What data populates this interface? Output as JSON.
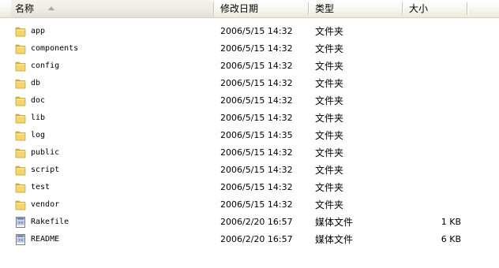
{
  "columns": {
    "name": "名称",
    "modified": "修改日期",
    "type": "类型",
    "size": "大小"
  },
  "files": [
    {
      "name": "app",
      "modified": "2006/5/15 14:32",
      "type": "文件夹",
      "size": "",
      "icon": "folder-icon"
    },
    {
      "name": "components",
      "modified": "2006/5/15 14:32",
      "type": "文件夹",
      "size": "",
      "icon": "folder-icon"
    },
    {
      "name": "config",
      "modified": "2006/5/15 14:32",
      "type": "文件夹",
      "size": "",
      "icon": "folder-icon"
    },
    {
      "name": "db",
      "modified": "2006/5/15 14:32",
      "type": "文件夹",
      "size": "",
      "icon": "folder-icon"
    },
    {
      "name": "doc",
      "modified": "2006/5/15 14:32",
      "type": "文件夹",
      "size": "",
      "icon": "folder-icon"
    },
    {
      "name": "lib",
      "modified": "2006/5/15 14:32",
      "type": "文件夹",
      "size": "",
      "icon": "folder-icon"
    },
    {
      "name": "log",
      "modified": "2006/5/15 14:35",
      "type": "文件夹",
      "size": "",
      "icon": "folder-icon"
    },
    {
      "name": "public",
      "modified": "2006/5/15 14:32",
      "type": "文件夹",
      "size": "",
      "icon": "folder-icon"
    },
    {
      "name": "script",
      "modified": "2006/5/15 14:32",
      "type": "文件夹",
      "size": "",
      "icon": "folder-icon"
    },
    {
      "name": "test",
      "modified": "2006/5/15 14:32",
      "type": "文件夹",
      "size": "",
      "icon": "folder-icon"
    },
    {
      "name": "vendor",
      "modified": "2006/5/15 14:32",
      "type": "文件夹",
      "size": "",
      "icon": "folder-icon"
    },
    {
      "name": "Rakefile",
      "modified": "2006/2/20 16:57",
      "type": "媒体文件",
      "size": "1 KB",
      "icon": "media-file-icon"
    },
    {
      "name": "README",
      "modified": "2006/2/20 16:57",
      "type": "媒体文件",
      "size": "6 KB",
      "icon": "media-file-icon"
    }
  ],
  "colors": {
    "folder_body": "#f3d56a",
    "folder_tab": "#e0b93c",
    "header_bg": "#ebeadb"
  }
}
